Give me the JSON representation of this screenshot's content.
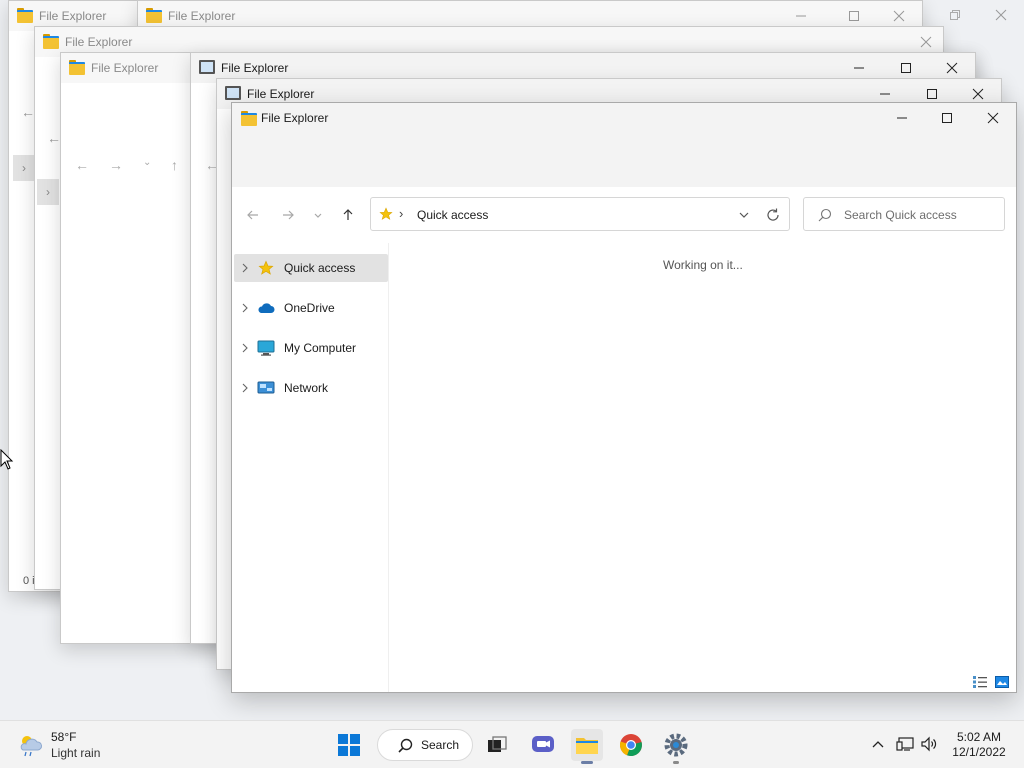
{
  "windows_back": [
    {
      "title": "File Explorer"
    },
    {
      "title": "File Explorer"
    },
    {
      "title": "File Explorer"
    },
    {
      "title": "File Explorer"
    },
    {
      "title": "File Explorer"
    },
    {
      "title": "File Explorer"
    }
  ],
  "back_status_fragment": "0 i",
  "main": {
    "title": "File Explorer",
    "address": {
      "crumb": "Quick access"
    },
    "search": {
      "placeholder": "Search Quick access"
    },
    "tree": [
      {
        "label": "Quick access",
        "icon": "star-icon",
        "selected": true
      },
      {
        "label": "OneDrive",
        "icon": "cloud-icon",
        "selected": false
      },
      {
        "label": "My Computer",
        "icon": "computer-icon",
        "selected": false
      },
      {
        "label": "Network",
        "icon": "network-icon",
        "selected": false
      }
    ],
    "status": "Working on it..."
  },
  "taskbar": {
    "weather": {
      "temp": "58°F",
      "condition": "Light rain"
    },
    "search_label": "Search",
    "clock": {
      "time": "5:02 AM",
      "date": "12/1/2022"
    }
  },
  "colors": {
    "accent": "#0067c0",
    "folder": "#f3c233",
    "star": "#f4c20d",
    "taskbar": "#f3f3f3"
  }
}
